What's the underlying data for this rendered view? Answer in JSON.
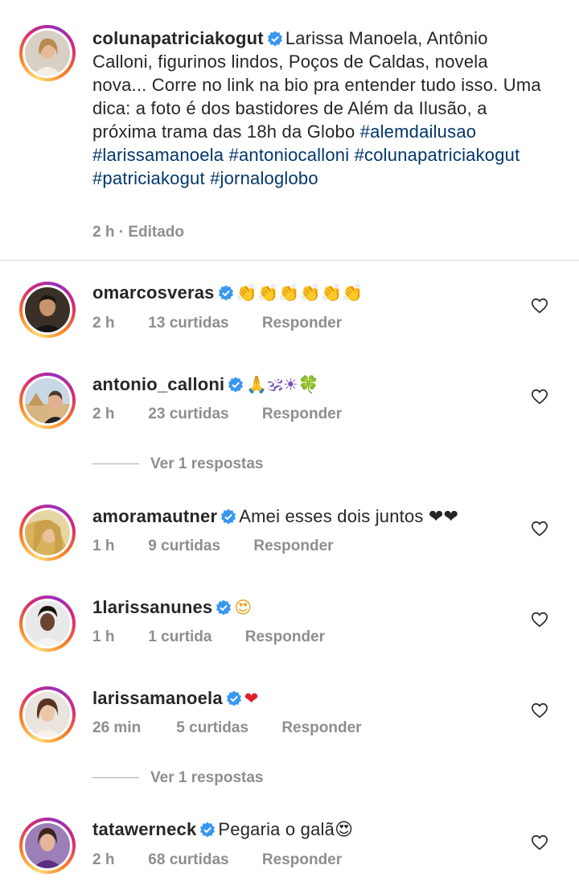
{
  "post": {
    "username": "colunapatriciakogut",
    "caption": "Larissa Manoela, Antônio Calloni, figurinos lindos, Poços de Caldas, novela nova... Corre no link na bio pra entender tudo isso. Uma dica: a foto é dos bastidores de Além da Ilusão, a próxima trama das 18h da Globo",
    "hashtags": [
      "#alemdailusao",
      "#larissamanoela",
      "#antoniocalloni",
      "#colunapatriciakogut",
      "#patriciakogut",
      "#jornaloglobo"
    ],
    "time": "2 h",
    "edited_label": "· Editado"
  },
  "comments": [
    {
      "username": "omarcosveras",
      "text": "👏👏👏👏👏👏",
      "time": "2 h",
      "likes": "13 curtidas",
      "reply": "Responder"
    },
    {
      "username": "antonio_calloni",
      "text": "🙏🕉☀🍀",
      "time": "2 h",
      "likes": "23 curtidas",
      "reply": "Responder",
      "view_replies": "Ver 1 respostas"
    },
    {
      "username": "amoramautner",
      "text": "Amei esses dois juntos ❤❤",
      "time": "1 h",
      "likes": "9 curtidas",
      "reply": "Responder"
    },
    {
      "username": "1larissanunes",
      "text": "😍",
      "time": "1 h",
      "likes": "1 curtida",
      "reply": "Responder"
    },
    {
      "username": "larissamanoela",
      "text": "❤",
      "time": "26 min",
      "likes": "5 curtidas",
      "reply": "Responder",
      "view_replies": "Ver 1 respostas"
    },
    {
      "username": "tatawerneck",
      "text": "Pegaria o galã😍",
      "time": "2 h",
      "likes": "68 curtidas",
      "reply": "Responder"
    }
  ],
  "icons": {
    "verified": "verified-badge-icon",
    "like": "heart-outline-icon"
  },
  "colors": {
    "verified": "#3897f0",
    "hashtag": "#00376b",
    "meta": "#8e8e8e"
  }
}
